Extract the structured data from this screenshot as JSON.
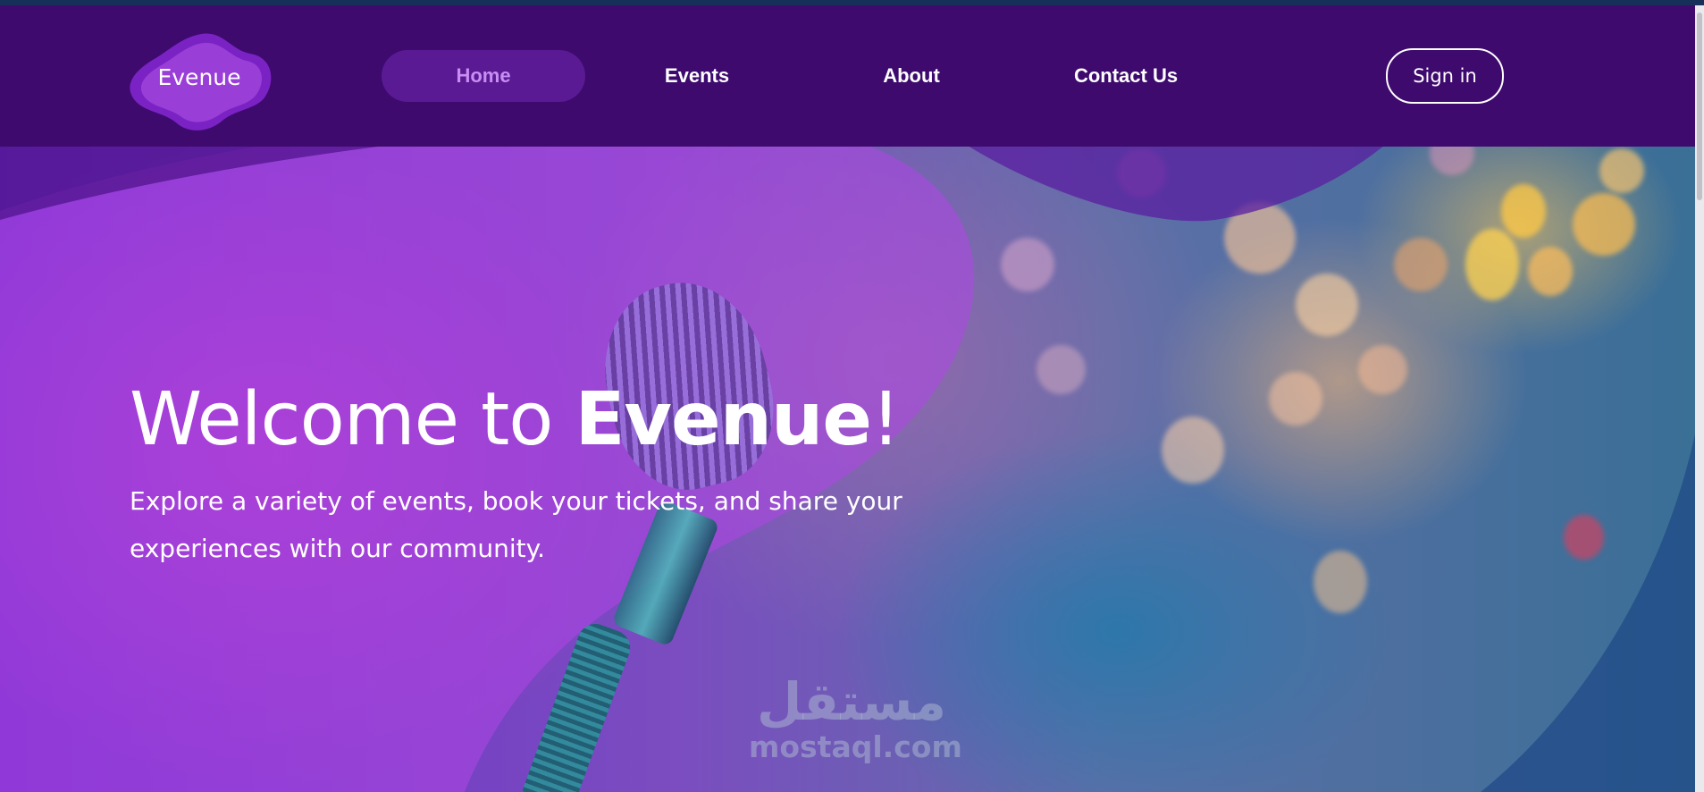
{
  "brand": {
    "logo_text": "Evenue"
  },
  "nav": {
    "items": [
      {
        "label": "Home",
        "active": true
      },
      {
        "label": "Events",
        "active": false
      },
      {
        "label": "About",
        "active": false
      },
      {
        "label": "Contact Us",
        "active": false
      }
    ],
    "signin_label": "Sign in"
  },
  "hero": {
    "title_prefix": "Welcome to ",
    "title_brand": "Evenue",
    "title_suffix": "!",
    "subtitle": "Explore a variety of events, book your tickets, and share your experiences with our community."
  },
  "watermark": {
    "arabic": "مستقل",
    "latin": "mostaql.com"
  },
  "colors": {
    "header_bg": "#3e0a6e",
    "active_nav_bg": "#5a1a94",
    "active_nav_text": "#c88ef2",
    "text": "#ffffff",
    "blob_magenta": "#b24ae0"
  },
  "icons": {
    "logo_shape": "blob-logo-icon",
    "hero_image": "microphone-concert-image"
  }
}
